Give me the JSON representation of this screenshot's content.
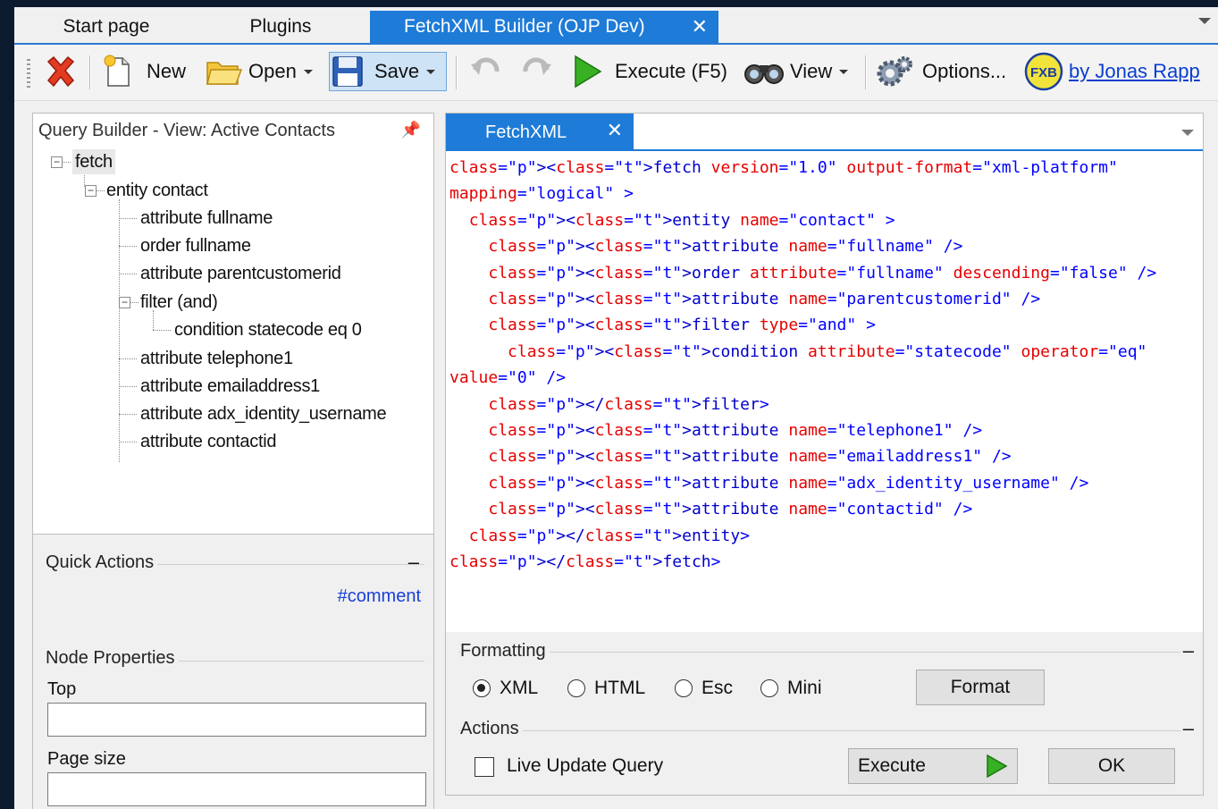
{
  "tabs": [
    {
      "label": "Start page",
      "active": false
    },
    {
      "label": "Plugins",
      "active": false
    },
    {
      "label": "FetchXML Builder (OJP Dev)",
      "active": true
    }
  ],
  "tab_close_glyph": "✕",
  "toolbar": {
    "new_label": "New",
    "open_label": "Open",
    "save_label": "Save",
    "execute_label": "Execute (F5)",
    "view_label": "View",
    "options_label": "Options...",
    "logo_text": "FXB",
    "author_link": "by Jonas Rapp"
  },
  "left_panel": {
    "title": "Query Builder - View: Active Contacts",
    "pin_glyph": "📌",
    "tree": [
      {
        "label": "fetch"
      },
      {
        "label": "entity contact"
      },
      {
        "label": "attribute fullname"
      },
      {
        "label": "order fullname"
      },
      {
        "label": "attribute parentcustomerid"
      },
      {
        "label": "filter (and)"
      },
      {
        "label": "condition statecode eq 0"
      },
      {
        "label": "attribute telephone1"
      },
      {
        "label": "attribute emailaddress1"
      },
      {
        "label": "attribute adx_identity_username"
      },
      {
        "label": "attribute contactid"
      }
    ],
    "expander_glyph": "−",
    "quick_actions_label": "Quick Actions",
    "comment_link": "#comment",
    "node_properties_label": "Node Properties",
    "top_label": "Top",
    "top_value": "",
    "page_size_label": "Page size",
    "page_size_value": "",
    "collapse_glyph": "–"
  },
  "editor": {
    "tab_label": "FetchXML",
    "code_lines": [
      "<fetch version=\"1.0\" output-format=\"xml-platform\"",
      "mapping=\"logical\" >",
      "  <entity name=\"contact\" >",
      "    <attribute name=\"fullname\" />",
      "    <order attribute=\"fullname\" descending=\"false\" />",
      "    <attribute name=\"parentcustomerid\" />",
      "    <filter type=\"and\" >",
      "      <condition attribute=\"statecode\" operator=\"eq\"",
      "value=\"0\" />",
      "    </filter>",
      "    <attribute name=\"telephone1\" />",
      "    <attribute name=\"emailaddress1\" />",
      "    <attribute name=\"adx_identity_username\" />",
      "    <attribute name=\"contactid\" />",
      "  </entity>",
      "</fetch>"
    ]
  },
  "formatting": {
    "label": "Formatting",
    "options": [
      {
        "label": "XML",
        "selected": true
      },
      {
        "label": "HTML",
        "selected": false
      },
      {
        "label": "Esc",
        "selected": false
      },
      {
        "label": "Mini",
        "selected": false
      }
    ],
    "format_button": "Format"
  },
  "actions": {
    "label": "Actions",
    "live_update_label": "Live Update Query",
    "live_update_checked": false,
    "execute_button": "Execute",
    "ok_button": "OK"
  },
  "colors": {
    "accent": "#1e7bd7",
    "xml_tag": "#a31515",
    "xml_attr": "#e60000",
    "xml_value": "#0000ff",
    "link": "#0a3ecf"
  }
}
